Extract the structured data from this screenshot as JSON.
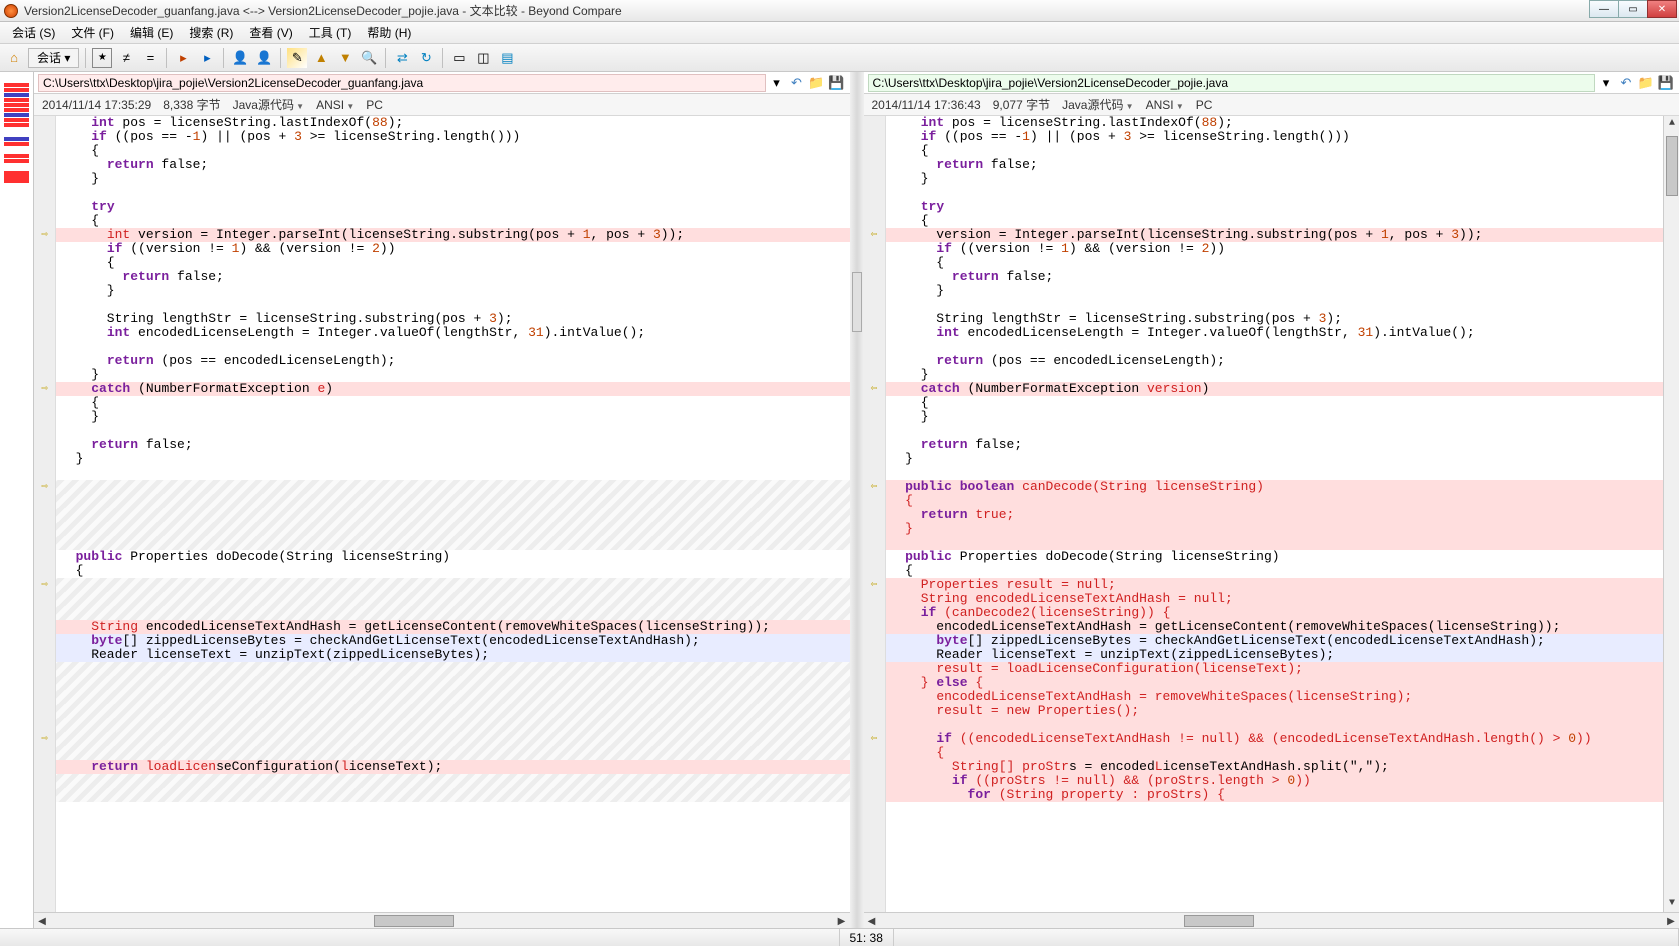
{
  "window": {
    "title": "Version2LicenseDecoder_guanfang.java <--> Version2LicenseDecoder_pojie.java - 文本比较 - Beyond Compare"
  },
  "menu": {
    "session": "会话 (S)",
    "file": "文件 (F)",
    "edit": "编辑 (E)",
    "search": "搜索 (R)",
    "view": "查看 (V)",
    "tools": "工具 (T)",
    "help": "帮助 (H)"
  },
  "toolbar": {
    "session_label": "会话 ▾"
  },
  "left": {
    "path": "C:\\Users\\ttx\\Desktop\\jira_pojie\\Version2LicenseDecoder_guanfang.java",
    "timestamp": "2014/11/14 17:35:29",
    "bytes": "8,338 字节",
    "filetype": "Java源代码",
    "encoding": "ANSI",
    "lineend": "PC"
  },
  "right": {
    "path": "C:\\Users\\ttx\\Desktop\\jira_pojie\\Version2LicenseDecoder_pojie.java",
    "timestamp": "2014/11/14 17:36:43",
    "bytes": "9,077 字节",
    "filetype": "Java源代码",
    "encoding": "ANSI",
    "lineend": "PC"
  },
  "status": {
    "cursor": "51: 38"
  },
  "code_left": [
    {
      "cls": "",
      "html": "    <span class='kw'>int</span> pos = licenseString.lastIndexOf(<span class='num'>88</span>);"
    },
    {
      "cls": "",
      "html": "    <span class='kw'>if</span> ((pos == -<span class='num'>1</span>) || (pos + <span class='num'>3</span> >= licenseString.length()))"
    },
    {
      "cls": "",
      "html": "    {"
    },
    {
      "cls": "",
      "html": "      <span class='kw'>return</span> false;"
    },
    {
      "cls": "",
      "html": "    }"
    },
    {
      "cls": "",
      "html": ""
    },
    {
      "cls": "",
      "html": "    <span class='kw'>try</span>"
    },
    {
      "cls": "",
      "html": "    {"
    },
    {
      "cls": "diff-left",
      "gut": "⇨",
      "html": "      <span class='reddiff'>int</span> version = Integer.parseInt(licenseString.substring(pos + <span class='num'>1</span>, pos + <span class='num'>3</span>));"
    },
    {
      "cls": "",
      "html": "      <span class='kw'>if</span> ((version != <span class='num'>1</span>) && (version != <span class='num'>2</span>))"
    },
    {
      "cls": "",
      "html": "      {"
    },
    {
      "cls": "",
      "html": "        <span class='kw'>return</span> false;"
    },
    {
      "cls": "",
      "html": "      }"
    },
    {
      "cls": "",
      "html": ""
    },
    {
      "cls": "",
      "html": "      String lengthStr = licenseString.substring(pos + <span class='num'>3</span>);"
    },
    {
      "cls": "",
      "html": "      <span class='kw'>int</span> encodedLicenseLength = Integer.valueOf(lengthStr, <span class='num'>31</span>).intValue();"
    },
    {
      "cls": "",
      "html": ""
    },
    {
      "cls": "",
      "html": "      <span class='kw'>return</span> (pos == encodedLicenseLength);"
    },
    {
      "cls": "",
      "html": "    }"
    },
    {
      "cls": "diff-left",
      "gut": "⇨",
      "html": "    <span class='kw'>catch</span> (NumberFormatException <span class='reddiff'>e</span>)"
    },
    {
      "cls": "",
      "html": "    {"
    },
    {
      "cls": "",
      "html": "    }"
    },
    {
      "cls": "",
      "html": ""
    },
    {
      "cls": "",
      "html": "    <span class='kw'>return</span> false;"
    },
    {
      "cls": "",
      "html": "  }"
    },
    {
      "cls": "",
      "html": ""
    },
    {
      "cls": "hatched",
      "gut": "⇨",
      "html": " "
    },
    {
      "cls": "hatched",
      "html": " "
    },
    {
      "cls": "hatched",
      "html": " "
    },
    {
      "cls": "hatched",
      "html": " "
    },
    {
      "cls": "hatched",
      "html": " "
    },
    {
      "cls": "",
      "html": "  <span class='kw'>public</span> Properties doDecode(String licenseString)"
    },
    {
      "cls": "",
      "html": "  {"
    },
    {
      "cls": "hatched",
      "gut": "⇨",
      "html": " "
    },
    {
      "cls": "hatched",
      "html": " "
    },
    {
      "cls": "hatched",
      "html": " "
    },
    {
      "cls": "diff-left",
      "html": "    <span class='reddiff'>String</span> encodedLicenseTextAndHash = getLicenseContent(removeWhiteSpaces(licenseString));"
    },
    {
      "cls": "diff-minor",
      "html": "    <span class='kw'>byte</span>[] zippedLicenseBytes = checkAndGetLicenseText(encodedLicenseTextAndHash);"
    },
    {
      "cls": "diff-minor",
      "html": "    Reader licenseText = unzipText(zippedLicenseBytes);"
    },
    {
      "cls": "hatched",
      "html": " "
    },
    {
      "cls": "hatched",
      "html": " "
    },
    {
      "cls": "hatched",
      "html": " "
    },
    {
      "cls": "hatched",
      "html": " "
    },
    {
      "cls": "hatched",
      "html": " "
    },
    {
      "cls": "hatched",
      "gut": "⇨",
      "html": " "
    },
    {
      "cls": "hatched",
      "html": " "
    },
    {
      "cls": "diff-left",
      "html": "    <span class='kw'>return</span> <span class='reddiff'>loadLicen</span>seConfiguration(<span class='reddiff'>l</span>icenseText);"
    },
    {
      "cls": "hatched",
      "html": " "
    },
    {
      "cls": "hatched",
      "html": " "
    }
  ],
  "code_right": [
    {
      "cls": "",
      "html": "    <span class='kw'>int</span> pos = licenseString.lastIndexOf(<span class='num'>88</span>);"
    },
    {
      "cls": "",
      "html": "    <span class='kw'>if</span> ((pos == -<span class='num'>1</span>) || (pos + <span class='num'>3</span> >= licenseString.length()))"
    },
    {
      "cls": "",
      "html": "    {"
    },
    {
      "cls": "",
      "html": "      <span class='kw'>return</span> false;"
    },
    {
      "cls": "",
      "html": "    }"
    },
    {
      "cls": "",
      "html": ""
    },
    {
      "cls": "",
      "html": "    <span class='kw'>try</span>"
    },
    {
      "cls": "",
      "html": "    {"
    },
    {
      "cls": "diff-right",
      "gut": "⇦",
      "html": "      version = Integer.parseInt(licenseString.substring(pos + <span class='num'>1</span>, pos + <span class='num'>3</span>));"
    },
    {
      "cls": "",
      "html": "      <span class='kw'>if</span> ((version != <span class='num'>1</span>) && (version != <span class='num'>2</span>))"
    },
    {
      "cls": "",
      "html": "      {"
    },
    {
      "cls": "",
      "html": "        <span class='kw'>return</span> false;"
    },
    {
      "cls": "",
      "html": "      }"
    },
    {
      "cls": "",
      "html": ""
    },
    {
      "cls": "",
      "html": "      String lengthStr = licenseString.substring(pos + <span class='num'>3</span>);"
    },
    {
      "cls": "",
      "html": "      <span class='kw'>int</span> encodedLicenseLength = Integer.valueOf(lengthStr, <span class='num'>31</span>).intValue();"
    },
    {
      "cls": "",
      "html": ""
    },
    {
      "cls": "",
      "html": "      <span class='kw'>return</span> (pos == encodedLicenseLength);"
    },
    {
      "cls": "",
      "html": "    }"
    },
    {
      "cls": "diff-right",
      "gut": "⇦",
      "html": "    <span class='kw'>catch</span> (NumberFormatException <span class='reddiff'>version</span>)"
    },
    {
      "cls": "",
      "html": "    {"
    },
    {
      "cls": "",
      "html": "    }"
    },
    {
      "cls": "",
      "html": ""
    },
    {
      "cls": "",
      "html": "    <span class='kw'>return</span> false;"
    },
    {
      "cls": "",
      "html": "  }"
    },
    {
      "cls": "",
      "html": ""
    },
    {
      "cls": "diff-right",
      "gut": "⇦",
      "html": "  <span class='reddiff'><span class='kw'>public</span> <span class='kw'>boolean</span> canDecode(String licenseString)</span>"
    },
    {
      "cls": "diff-right",
      "html": "  <span class='reddiff'>{</span>"
    },
    {
      "cls": "diff-right",
      "html": "    <span class='reddiff'><span class='kw'>return</span> true;</span>"
    },
    {
      "cls": "diff-right",
      "html": "  <span class='reddiff'>}</span>"
    },
    {
      "cls": "diff-right",
      "html": ""
    },
    {
      "cls": "",
      "html": "  <span class='kw'>public</span> Properties doDecode(String licenseString)"
    },
    {
      "cls": "",
      "html": "  {"
    },
    {
      "cls": "diff-right",
      "gut": "⇦",
      "html": "    <span class='reddiff'>Properties result = null;</span>"
    },
    {
      "cls": "diff-right",
      "html": "    <span class='reddiff'>String encodedLicenseTextAndHash = null;</span>"
    },
    {
      "cls": "diff-right",
      "html": "    <span class='reddiff'><span class='kw'>if</span> (canDecode2(licenseString)) {</span>"
    },
    {
      "cls": "diff-right",
      "html": "      encodedLicenseTextAndHash = getLicenseContent(removeWhiteSpaces(licenseString));"
    },
    {
      "cls": "diff-minor",
      "html": "      <span class='kw'>byte</span>[] zippedLicenseBytes = checkAndGetLicenseText(encodedLicenseTextAndHash);"
    },
    {
      "cls": "diff-minor",
      "html": "      Reader licenseText = unzipText(zippedLicenseBytes);"
    },
    {
      "cls": "diff-right",
      "html": "      <span class='reddiff'>result = loadLicenseConfiguration(licenseText);</span>"
    },
    {
      "cls": "diff-right",
      "html": "    <span class='reddiff'>} <span class='kw'>else</span> {</span>"
    },
    {
      "cls": "diff-right",
      "html": "      <span class='reddiff'>encodedLicenseTextAndHash = removeWhiteSpaces(licenseString);</span>"
    },
    {
      "cls": "diff-right",
      "html": "      <span class='reddiff'>result = new Properties();</span>"
    },
    {
      "cls": "diff-right",
      "html": ""
    },
    {
      "cls": "diff-right",
      "gut": "⇦",
      "html": "      <span class='reddiff'><span class='kw'>if</span> ((encodedLicenseTextAndHash != null) && (encodedLicenseTextAndHash.length() > <span class='num'>0</span>))</span>"
    },
    {
      "cls": "diff-right",
      "html": "      <span class='reddiff'>{</span>"
    },
    {
      "cls": "diff-right",
      "html": "        <span class='reddiff'>String[] proStr</span>s = encoded<span class='reddiff'>L</span>icenseTextAndHash.split(\",\");"
    },
    {
      "cls": "diff-right",
      "html": "        <span class='reddiff'><span class='kw'>if</span> ((proStrs != null) && (proStrs.length > <span class='num'>0</span>))</span>"
    },
    {
      "cls": "diff-right",
      "html": "          <span class='reddiff'><span class='kw'>for</span> (String property : proStrs) {</span>"
    }
  ]
}
